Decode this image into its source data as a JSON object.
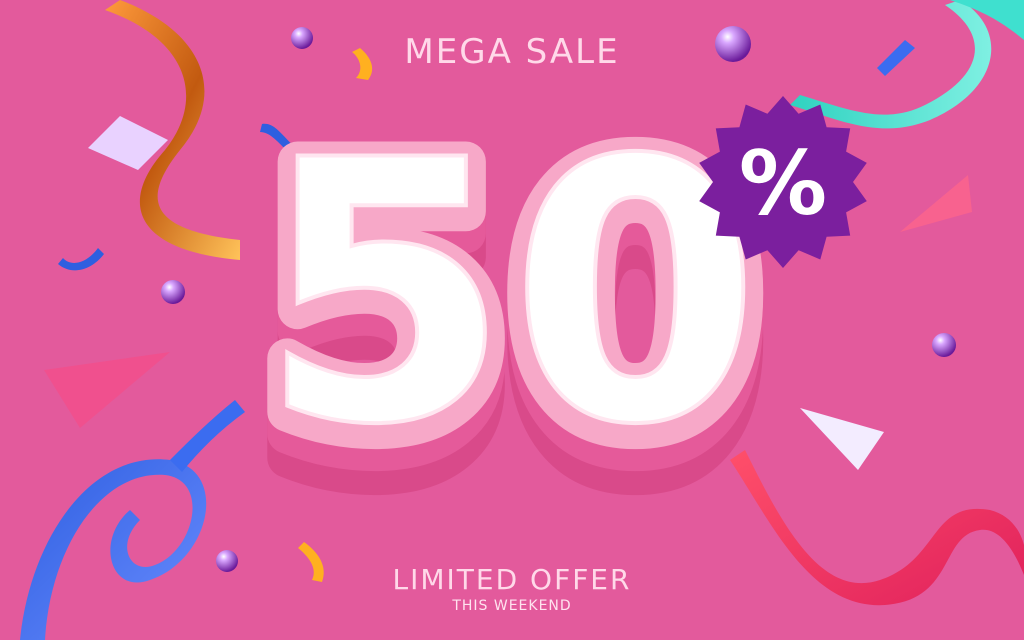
{
  "headline": "MEGA SALE",
  "discount": "50",
  "percent_sign": "%",
  "offer": "LIMITED OFFER",
  "offer_sub": "THIS WEEKEND",
  "colors": {
    "background": "#e35a9c",
    "numeral_face": "#ffffff",
    "numeral_outline": "#f7a8c8",
    "numeral_side": "#e25093",
    "badge": "#7b1f9e"
  }
}
